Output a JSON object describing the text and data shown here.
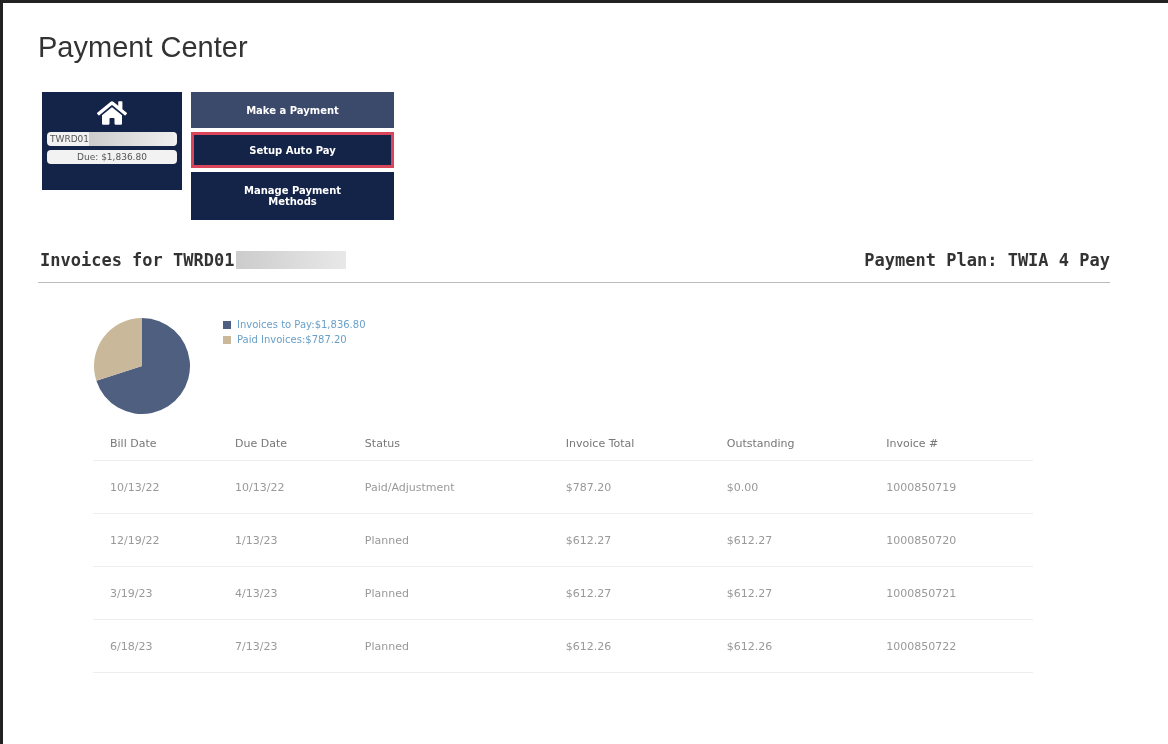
{
  "title": "Payment Center",
  "account": {
    "id": "TWRD01",
    "due": "Due: $1,836.80"
  },
  "actions": [
    {
      "label": "Make a Payment",
      "highlighted": false,
      "hover": true
    },
    {
      "label": "Setup Auto Pay",
      "highlighted": true,
      "hover": false
    },
    {
      "label": "Manage Payment Methods",
      "highlighted": false,
      "hover": false
    }
  ],
  "invoices_heading": "Invoices for TWRD01",
  "payment_plan": "Payment Plan: TWIA 4 Pay",
  "summary": {
    "chart_data": {
      "type": "pie",
      "categories": [
        "Invoices to Pay:$1,836.80",
        "Paid Invoices:$787.20"
      ],
      "series": [
        {
          "values": [
            70,
            30
          ]
        }
      ],
      "colors": [
        "#4e5f80",
        "#c9b899"
      ]
    }
  },
  "table": {
    "columns": [
      "Bill Date",
      "Due Date",
      "Status",
      "Invoice Total",
      "Outstanding",
      "Invoice #"
    ],
    "rows": [
      [
        "10/13/22",
        "10/13/22",
        "Paid/Adjustment",
        "$787.20",
        "$0.00",
        "1000850719"
      ],
      [
        "12/19/22",
        "1/13/23",
        "Planned",
        "$612.27",
        "$612.27",
        "1000850720"
      ],
      [
        "3/19/23",
        "4/13/23",
        "Planned",
        "$612.27",
        "$612.27",
        "1000850721"
      ],
      [
        "6/18/23",
        "7/13/23",
        "Planned",
        "$612.26",
        "$612.26",
        "1000850722"
      ]
    ]
  }
}
